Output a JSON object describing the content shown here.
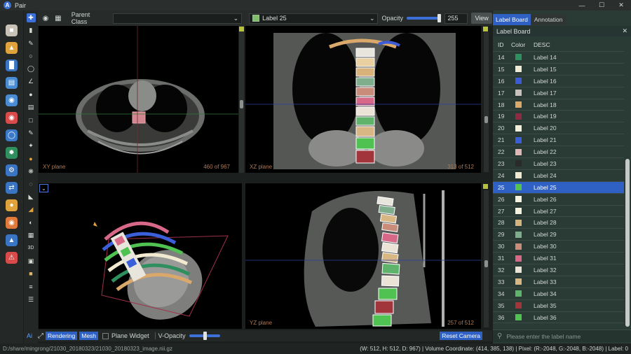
{
  "window": {
    "title": "Pair",
    "logo_letter": "A"
  },
  "toolbar": {
    "parent_class_label": "Parent Class",
    "parent_class_value": "",
    "label_value": "Label 25",
    "label_color": "#7fbf6a",
    "opacity_label": "Opacity",
    "opacity_value": "255",
    "view_button": "View"
  },
  "viewports": {
    "xy": {
      "label": "XY plane",
      "slice": "460 of 967"
    },
    "xz": {
      "label": "XZ plane",
      "slice": "313 of 512"
    },
    "yz": {
      "label": "YZ plane",
      "slice": "257 of 512"
    }
  },
  "bottombar": {
    "ai": "Ai",
    "rendering": "Rendering",
    "mesh": "Mesh",
    "plane_widget": "Plane Widget",
    "v_opacity": "V-Opacity",
    "reset_camera": "Reset Camera"
  },
  "right_panel": {
    "tabs": [
      "Label Board",
      "Annotation"
    ],
    "header": "Label Board",
    "columns": [
      "ID",
      "Color",
      "DESC"
    ],
    "rows": [
      {
        "id": "14",
        "color": "#2f8f5e",
        "desc": "Label 14"
      },
      {
        "id": "15",
        "color": "#f1ead6",
        "desc": "Label 15"
      },
      {
        "id": "16",
        "color": "#3d5bd6",
        "desc": "Label 16"
      },
      {
        "id": "17",
        "color": "#c9c1bd",
        "desc": "Label 17"
      },
      {
        "id": "18",
        "color": "#d9a86a",
        "desc": "Label 18"
      },
      {
        "id": "19",
        "color": "#8e2a44",
        "desc": "Label 19"
      },
      {
        "id": "20",
        "color": "#f4f0dc",
        "desc": "Label 20"
      },
      {
        "id": "21",
        "color": "#3a5fd8",
        "desc": "Label 21"
      },
      {
        "id": "22",
        "color": "#e0b7b7",
        "desc": "Label 22"
      },
      {
        "id": "23",
        "color": "#2a2a2a",
        "desc": "Label 23"
      },
      {
        "id": "24",
        "color": "#f2ead0",
        "desc": "Label 24"
      },
      {
        "id": "25",
        "color": "#55c24e",
        "desc": "Label 25"
      },
      {
        "id": "26",
        "color": "#f6f2e2",
        "desc": "Label 26"
      },
      {
        "id": "27",
        "color": "#f6f2e2",
        "desc": "Label 27"
      },
      {
        "id": "28",
        "color": "#d6b47e",
        "desc": "Label 28"
      },
      {
        "id": "29",
        "color": "#7fae8c",
        "desc": "Label 29"
      },
      {
        "id": "30",
        "color": "#c98b7a",
        "desc": "Label 30"
      },
      {
        "id": "31",
        "color": "#d86888",
        "desc": "Label 31"
      },
      {
        "id": "32",
        "color": "#ebe3d6",
        "desc": "Label 32"
      },
      {
        "id": "33",
        "color": "#d9b784",
        "desc": "Label 33"
      },
      {
        "id": "34",
        "color": "#5fb36a",
        "desc": "Label 34"
      },
      {
        "id": "35",
        "color": "#a2353c",
        "desc": "Label 35"
      },
      {
        "id": "36",
        "color": "#4fc252",
        "desc": "Label 36"
      }
    ],
    "selected_id": "25",
    "search_placeholder": "Please enter the label name"
  },
  "status": {
    "path": "D:/share/mingrong/21030_20180323/21030_20180323_image.nii.gz",
    "info": "(W: 512, H: 512, D: 967) | Volume Coordinate: (414, 385, 138) | Pixel: (R:-2048, G:-2048, B:-2048) | Label: 0"
  }
}
